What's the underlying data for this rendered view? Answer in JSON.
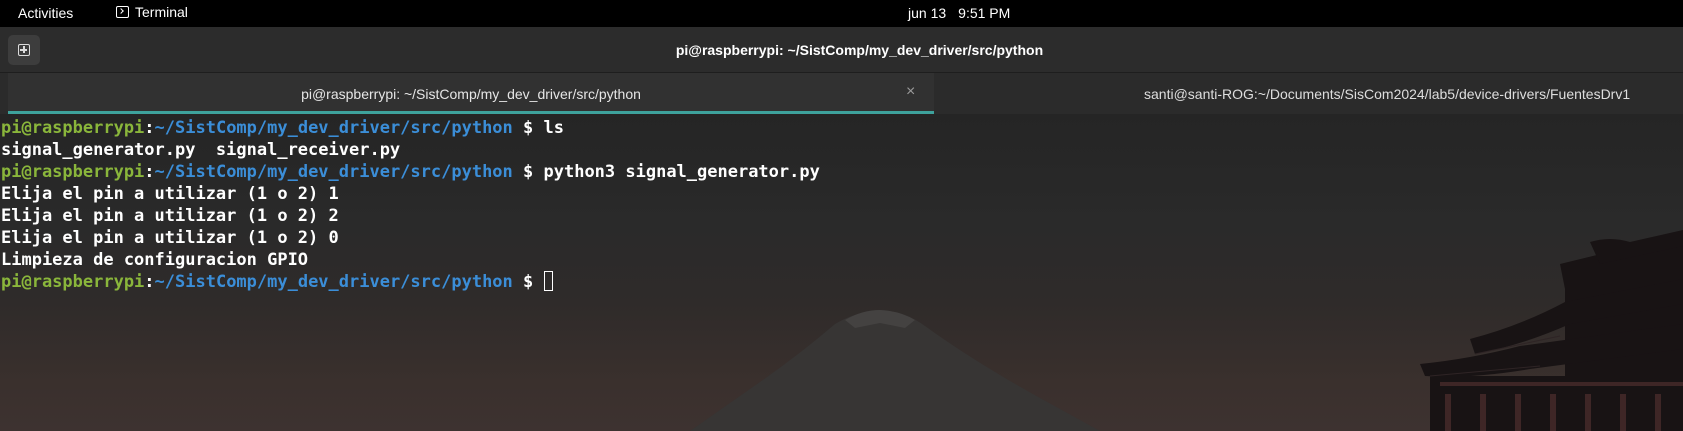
{
  "topbar": {
    "activities": "Activities",
    "app_name": "Terminal",
    "app_icon": "terminal-icon",
    "date": "jun 13",
    "time": "9:51 PM"
  },
  "header": {
    "new_tab_icon": "new-tab-icon",
    "title": "pi@raspberrypi: ~/SistComp/my_dev_driver/src/python"
  },
  "tabs": [
    {
      "label": "pi@raspberrypi: ~/SistComp/my_dev_driver/src/python",
      "active": true,
      "close": "×"
    },
    {
      "label": "santi@santi-ROG:~/Documents/SisCom2024/lab5/device-drivers/FuentesDrv1",
      "active": false
    }
  ],
  "terminal": {
    "prompt_user": "pi@raspberrypi",
    "prompt_colon": ":",
    "prompt_path": "~/SistComp/my_dev_driver/src/python",
    "prompt_symbol": " $ ",
    "lines": [
      {
        "type": "prompt",
        "command": "ls"
      },
      {
        "type": "output",
        "text": "signal_generator.py  signal_receiver.py"
      },
      {
        "type": "prompt",
        "command": "python3 signal_generator.py"
      },
      {
        "type": "output",
        "text": "Elija el pin a utilizar (1 o 2) 1"
      },
      {
        "type": "output",
        "text": "Elija el pin a utilizar (1 o 2) 2"
      },
      {
        "type": "output",
        "text": "Elija el pin a utilizar (1 o 2) 0"
      },
      {
        "type": "output",
        "text": "Limpieza de configuracion GPIO"
      },
      {
        "type": "prompt",
        "command": "",
        "cursor": true
      }
    ]
  },
  "colors": {
    "user": "#8ab63b",
    "path": "#3b8ed8",
    "tab_indicator": "#3ea29c"
  }
}
